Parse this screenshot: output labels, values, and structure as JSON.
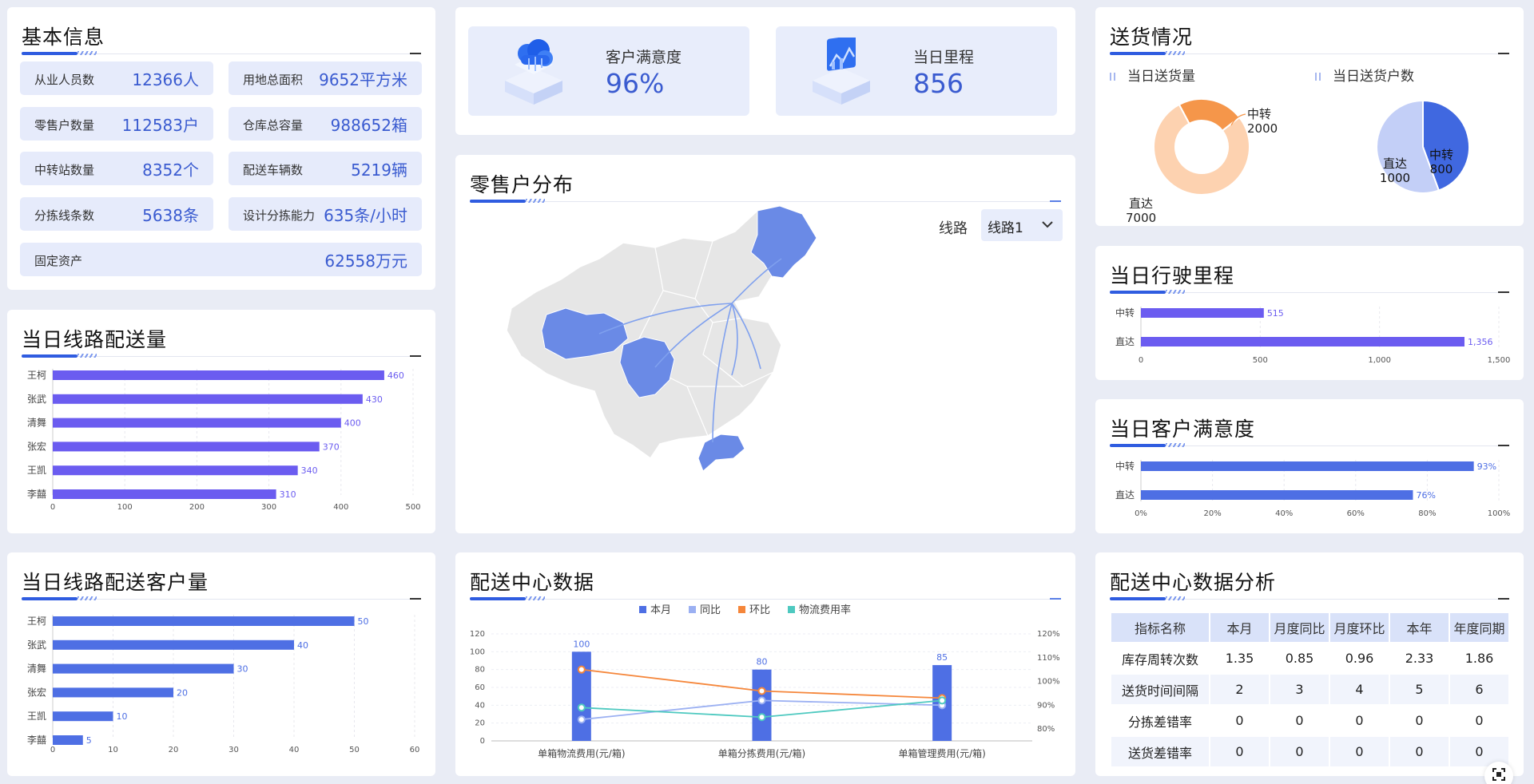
{
  "basic_info": {
    "title": "基本信息",
    "items": [
      {
        "label": "从业人员数",
        "value": "12366人"
      },
      {
        "label": "用地总面积",
        "value": "9652平方米"
      },
      {
        "label": "零售户数量",
        "value": "112583户"
      },
      {
        "label": "仓库总容量",
        "value": "988652箱"
      },
      {
        "label": "中转站数量",
        "value": "8352个"
      },
      {
        "label": "配送车辆数",
        "value": "5219辆"
      },
      {
        "label": "分拣线条数",
        "value": "5638条"
      },
      {
        "label": "设计分拣能力",
        "value": "635条/小时"
      },
      {
        "label": "固定资产",
        "value": "62558万元"
      }
    ]
  },
  "kpis": [
    {
      "label": "客户满意度",
      "value": "96%",
      "icon": "cloud-cube-icon"
    },
    {
      "label": "当日里程",
      "value": "856",
      "icon": "chart-cube-icon"
    }
  ],
  "map": {
    "title": "零售户分布",
    "route_label": "线路",
    "route_value": "线路1"
  },
  "table": {
    "title": "配送中心数据分析",
    "headers": [
      "指标名称",
      "本月",
      "月度同比",
      "月度环比",
      "本年",
      "年度同期"
    ],
    "rows": [
      [
        "库存周转次数",
        "1.35",
        "0.85",
        "0.96",
        "2.33",
        "1.86"
      ],
      [
        "送货时间间隔",
        "2",
        "3",
        "4",
        "5",
        "6"
      ],
      [
        "分拣差错率",
        "0",
        "0",
        "0",
        "0",
        "0"
      ],
      [
        "送货差错率",
        "0",
        "0",
        "0",
        "0",
        "0"
      ]
    ]
  },
  "chart_data": [
    {
      "id": "route-delivery",
      "type": "bar",
      "orientation": "horizontal",
      "title": "当日线路配送量",
      "categories": [
        "王柯",
        "张武",
        "清舞",
        "张宏",
        "王凯",
        "李囍"
      ],
      "values": [
        460,
        430,
        400,
        370,
        340,
        310
      ],
      "xlim": [
        0,
        500
      ],
      "ticks": [
        0,
        100,
        200,
        300,
        400,
        500
      ],
      "color": "#6b5cf0",
      "grid": true
    },
    {
      "id": "route-customers",
      "type": "bar",
      "orientation": "horizontal",
      "title": "当日线路配送客户量",
      "categories": [
        "王柯",
        "张武",
        "清舞",
        "张宏",
        "王凯",
        "李囍"
      ],
      "values": [
        50,
        40,
        30,
        20,
        10,
        5
      ],
      "xlim": [
        0,
        60
      ],
      "ticks": [
        0,
        10,
        20,
        30,
        40,
        50,
        60
      ],
      "color": "#4e6fe4",
      "grid": true
    },
    {
      "id": "delivery-status",
      "type": "pie",
      "title": "送货情况",
      "charts": [
        {
          "legend": "当日送货量",
          "donut": true,
          "slices": [
            {
              "name": "中转",
              "value": 2000,
              "color": "#f5964a"
            },
            {
              "name": "直达",
              "value": 7000,
              "color": "#fdd2b0"
            }
          ]
        },
        {
          "legend": "当日送货户数",
          "donut": false,
          "slices": [
            {
              "name": "中转",
              "value": 800,
              "color": "#4068e0"
            },
            {
              "name": "直达",
              "value": 1000,
              "color": "#c3cff7"
            }
          ]
        }
      ]
    },
    {
      "id": "mileage",
      "type": "bar",
      "orientation": "horizontal",
      "title": "当日行驶里程",
      "categories": [
        "中转",
        "直达"
      ],
      "values": [
        515,
        1356
      ],
      "labels": [
        "515",
        "1,356"
      ],
      "xlim": [
        0,
        1500
      ],
      "ticks": [
        "0",
        "500",
        "1,000",
        "1,500"
      ],
      "color": "#6b5cf0",
      "grid": true
    },
    {
      "id": "satisfaction",
      "type": "bar",
      "orientation": "horizontal",
      "title": "当日客户满意度",
      "categories": [
        "中转",
        "直达"
      ],
      "values": [
        93,
        76
      ],
      "labels": [
        "93%",
        "76%"
      ],
      "xlim": [
        0,
        100
      ],
      "ticks": [
        "0%",
        "20%",
        "40%",
        "60%",
        "80%",
        "100%"
      ],
      "color": "#4e6fe4",
      "grid": true
    },
    {
      "id": "center-data",
      "type": "bar",
      "title": "配送中心数据",
      "categories": [
        "单箱物流费用(元/箱)",
        "单箱分拣费用(元/箱)",
        "单箱管理费用(元/箱)"
      ],
      "series": [
        {
          "name": "本月",
          "type": "bar",
          "values": [
            100,
            80,
            85
          ],
          "color": "#4e6fe4",
          "axis": "left"
        },
        {
          "name": "同比",
          "type": "line",
          "values": [
            84,
            92,
            90
          ],
          "color": "#9bb0f2",
          "axis": "right"
        },
        {
          "name": "环比",
          "type": "line",
          "values": [
            105,
            96,
            93
          ],
          "color": "#f5863a",
          "axis": "right"
        },
        {
          "name": "物流费用率",
          "type": "line",
          "values": [
            89,
            85,
            92
          ],
          "color": "#4ec9c0",
          "axis": "right"
        }
      ],
      "y_left": {
        "min": 0,
        "max": 120,
        "ticks": [
          0,
          20,
          40,
          60,
          80,
          100,
          120
        ]
      },
      "y_right": {
        "min": 75,
        "max": 120,
        "ticks": [
          "80%",
          "90%",
          "100%",
          "110%",
          "120%"
        ],
        "tick_values": [
          80,
          90,
          100,
          110,
          120
        ]
      },
      "legend_position": "top-center"
    }
  ]
}
